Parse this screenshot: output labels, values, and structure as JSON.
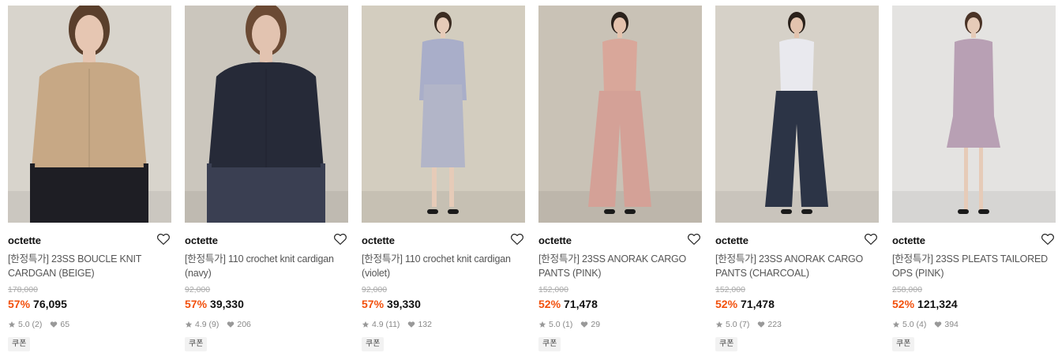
{
  "products": [
    {
      "brand": "octette",
      "name": "[한정특가] 23SS BOUCLE KNIT CARDGAN (BEIGE)",
      "original_price": "178,000",
      "discount": "57%",
      "sale_price": "76,095",
      "rating": "5.0",
      "reviews": "(2)",
      "likes": "65",
      "badge": "쿠폰",
      "colors": {
        "bg": "#d8d4cc",
        "top": "#c7a885",
        "bottom": "#1e1e24",
        "skin": "#e6c6b2",
        "hair": "#5a3f2c"
      }
    },
    {
      "brand": "octette",
      "name": "[한정특가] 110 crochet knit cardigan (navy)",
      "original_price": "92,000",
      "discount": "57%",
      "sale_price": "39,330",
      "rating": "4.9",
      "reviews": "(9)",
      "likes": "206",
      "badge": "쿠폰",
      "colors": {
        "bg": "#cbc6bd",
        "top": "#262a38",
        "bottom": "#3a3f52",
        "skin": "#e2c3b0",
        "hair": "#6b4a34"
      }
    },
    {
      "brand": "octette",
      "name": "[한정특가] 110 crochet knit cardigan (violet)",
      "original_price": "92,000",
      "discount": "57%",
      "sale_price": "39,330",
      "rating": "4.9",
      "reviews": "(11)",
      "likes": "132",
      "badge": "쿠폰",
      "colors": {
        "bg": "#d3cdbf",
        "top": "#a9aec9",
        "bottom": "#b2b5c8",
        "skin": "#e6cbb8",
        "hair": "#3b2c22"
      }
    },
    {
      "brand": "octette",
      "name": "[한정특가] 23SS ANORAK CARGO PANTS (PINK)",
      "original_price": "152,000",
      "discount": "52%",
      "sale_price": "71,478",
      "rating": "5.0",
      "reviews": "(1)",
      "likes": "29",
      "badge": "쿠폰",
      "colors": {
        "bg": "#c9c2b6",
        "top": "#d9a79a",
        "bottom": "#d4a197",
        "skin": "#e4c2ad",
        "hair": "#2a211b"
      }
    },
    {
      "brand": "octette",
      "name": "[한정특가] 23SS ANORAK CARGO PANTS (CHARCOAL)",
      "original_price": "152,000",
      "discount": "52%",
      "sale_price": "71,478",
      "rating": "5.0",
      "reviews": "(7)",
      "likes": "223",
      "badge": "쿠폰",
      "colors": {
        "bg": "#d6d1c8",
        "top": "#e9e9ee",
        "bottom": "#2c3446",
        "skin": "#e2c3ae",
        "hair": "#2a211b"
      }
    },
    {
      "brand": "octette",
      "name": "[한정특가] 23SS PLEATS TAILORED OPS (PINK)",
      "original_price": "258,000",
      "discount": "52%",
      "sale_price": "121,324",
      "rating": "5.0",
      "reviews": "(4)",
      "likes": "394",
      "badge": "쿠폰",
      "colors": {
        "bg": "#e4e3e1",
        "top": "#b8a0b4",
        "bottom": "#b39ab0",
        "skin": "#e6cbb8",
        "hair": "#4a3326"
      }
    }
  ]
}
